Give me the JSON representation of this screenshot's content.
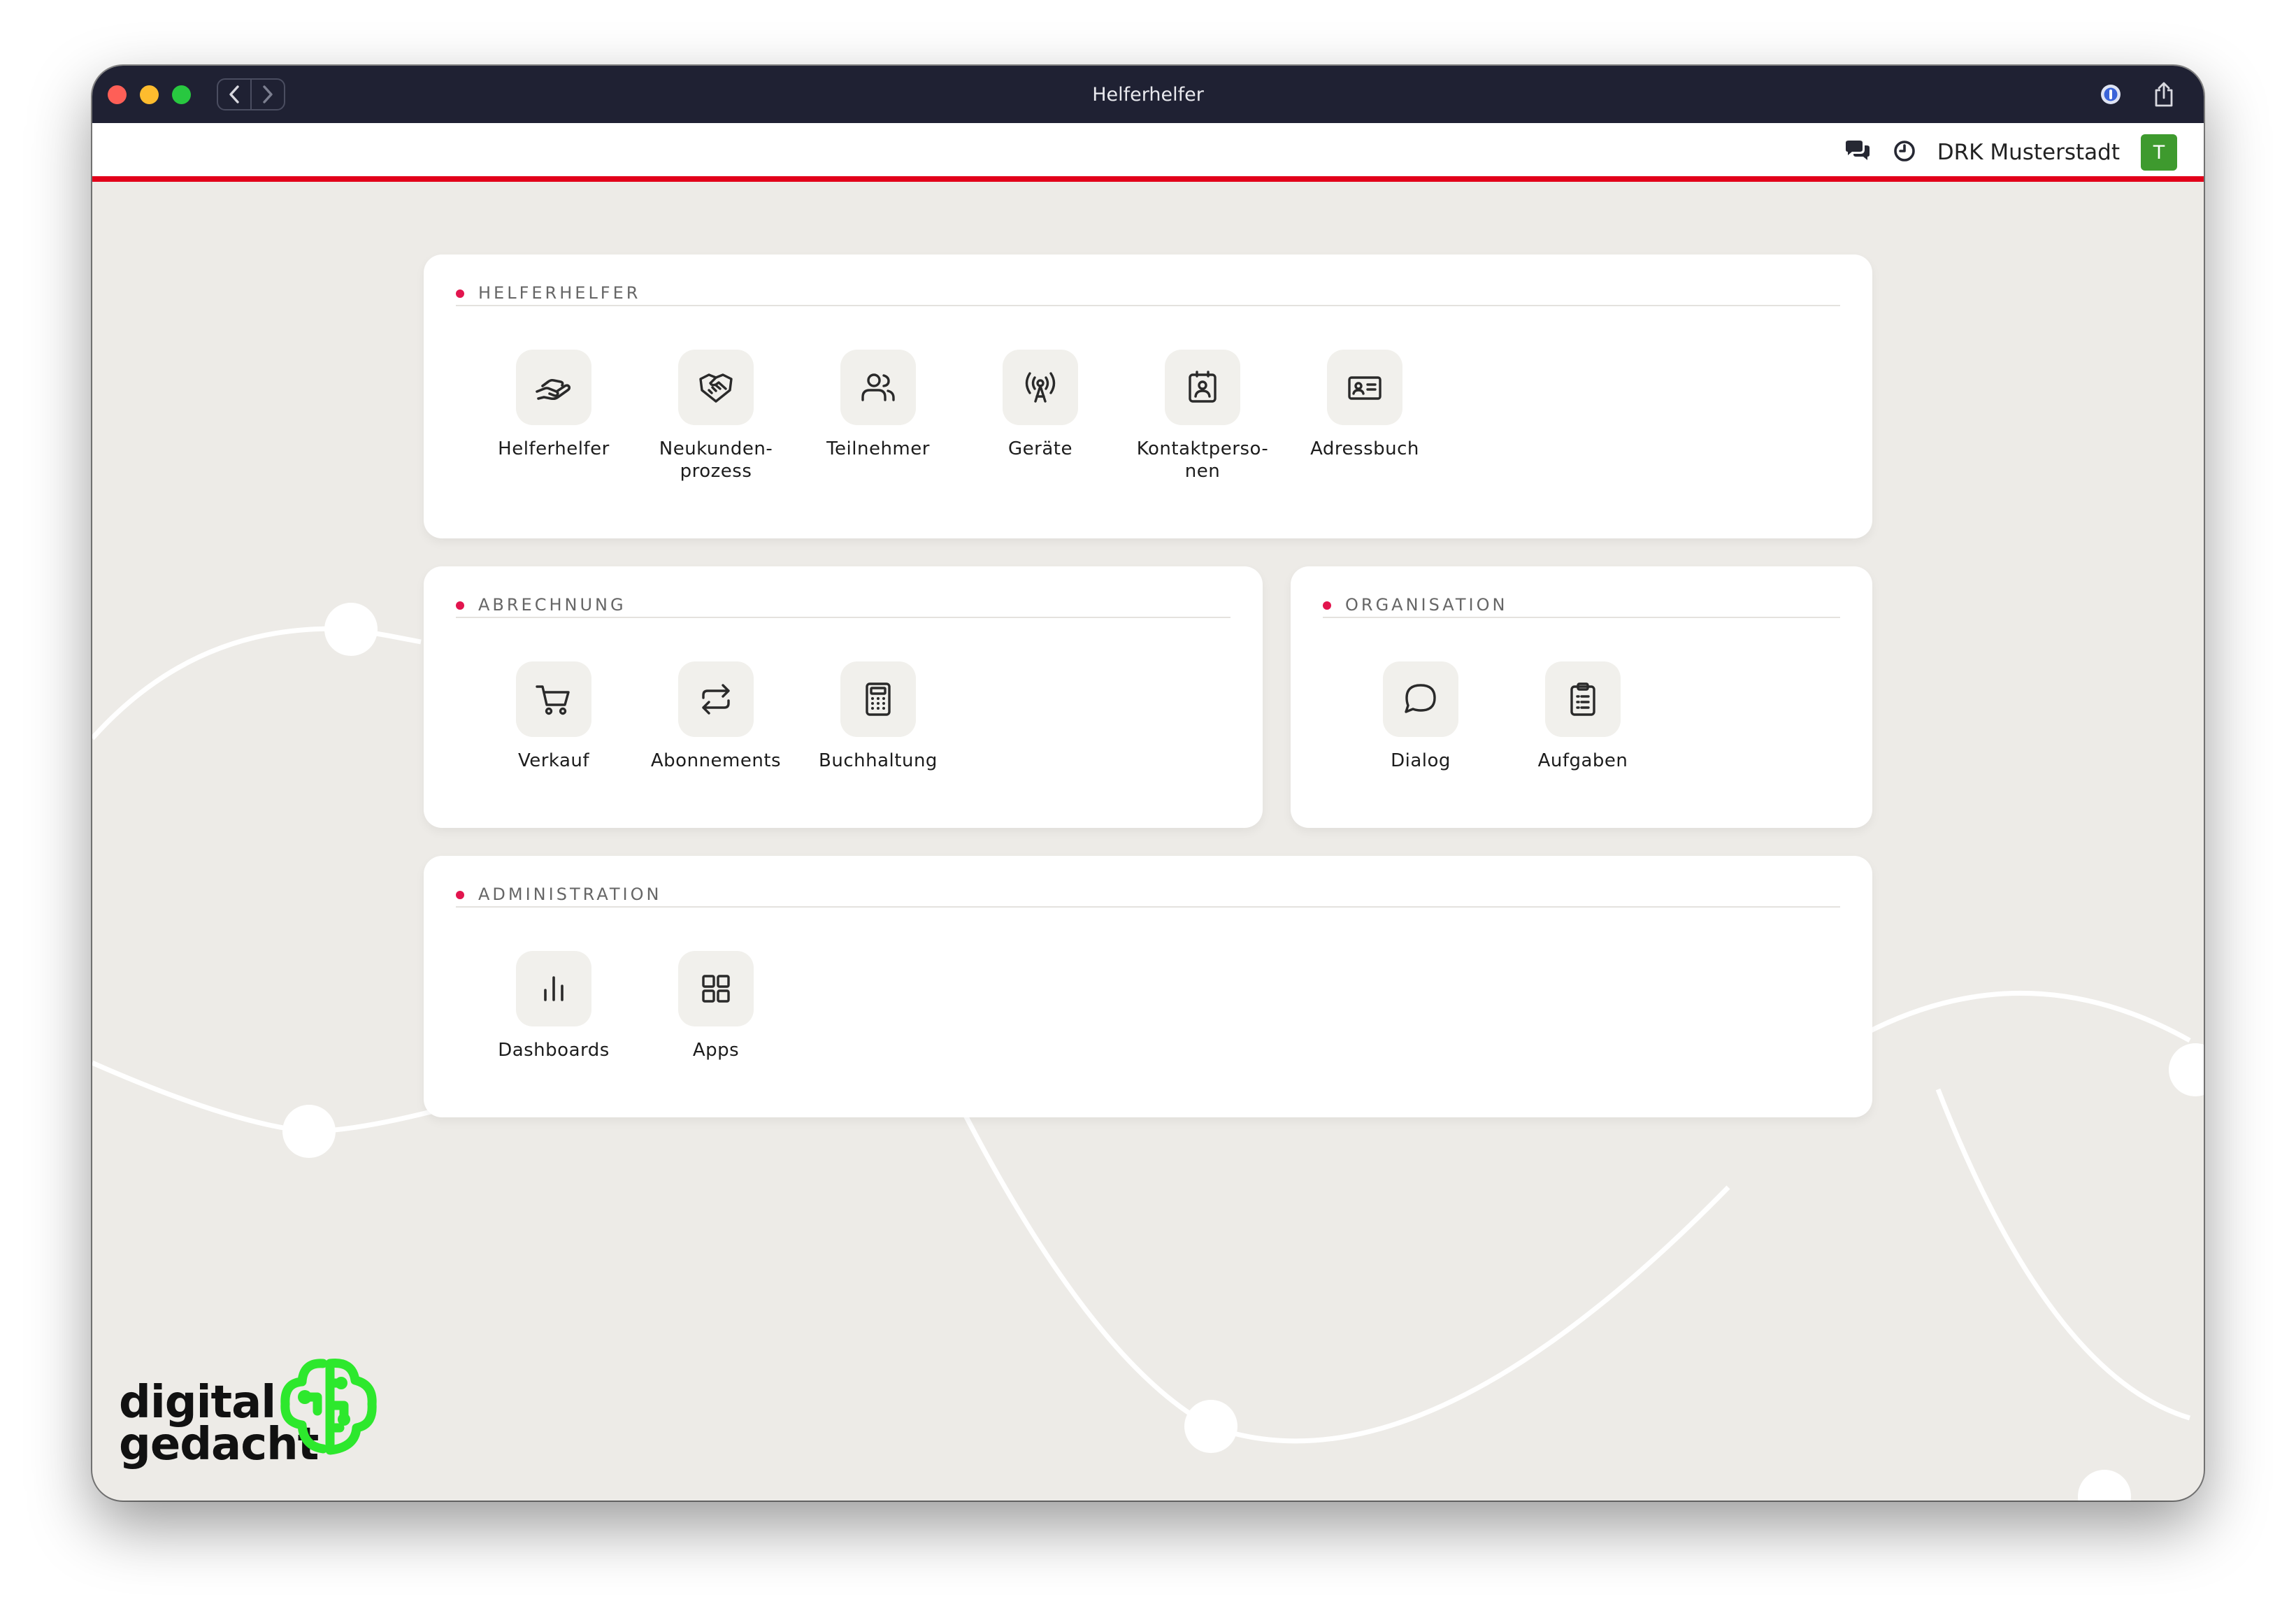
{
  "window": {
    "title": "Helferhelfer"
  },
  "topbar": {
    "organization": "DRK Musterstadt",
    "avatar_initial": "T"
  },
  "sections": {
    "helferhelfer": {
      "title": "HELFERHELFER",
      "tiles": [
        {
          "label": "Helferhelfer",
          "icon": "hand-heart-icon"
        },
        {
          "label": "Neukunden-\nprozess",
          "icon": "handshake-icon"
        },
        {
          "label": "Teilnehmer",
          "icon": "users-icon"
        },
        {
          "label": "Geräte",
          "icon": "broadcast-antenna-icon"
        },
        {
          "label": "Kontaktperso-\nnen",
          "icon": "contact-badge-icon"
        },
        {
          "label": "Adressbuch",
          "icon": "id-card-icon"
        }
      ]
    },
    "abrechnung": {
      "title": "ABRECHNUNG",
      "tiles": [
        {
          "label": "Verkauf",
          "icon": "shopping-cart-icon"
        },
        {
          "label": "Abonnements",
          "icon": "repeat-arrows-icon"
        },
        {
          "label": "Buchhaltung",
          "icon": "calculator-icon"
        }
      ]
    },
    "organisation": {
      "title": "ORGANISATION",
      "tiles": [
        {
          "label": "Dialog",
          "icon": "chat-bubble-icon"
        },
        {
          "label": "Aufgaben",
          "icon": "clipboard-list-icon"
        }
      ]
    },
    "administration": {
      "title": "ADMINISTRATION",
      "tiles": [
        {
          "label": "Dashboards",
          "icon": "bar-chart-icon"
        },
        {
          "label": "Apps",
          "icon": "grid-icon"
        }
      ]
    }
  },
  "logo": {
    "line1": "digital",
    "line2": "gedacht",
    "brand_color": "#2de82d"
  },
  "colors": {
    "accent_red": "#e2001a",
    "section_dot": "#e2154e",
    "avatar_green": "#3e9a2e",
    "titlebar": "#1f2133",
    "background": "#edebe7"
  }
}
